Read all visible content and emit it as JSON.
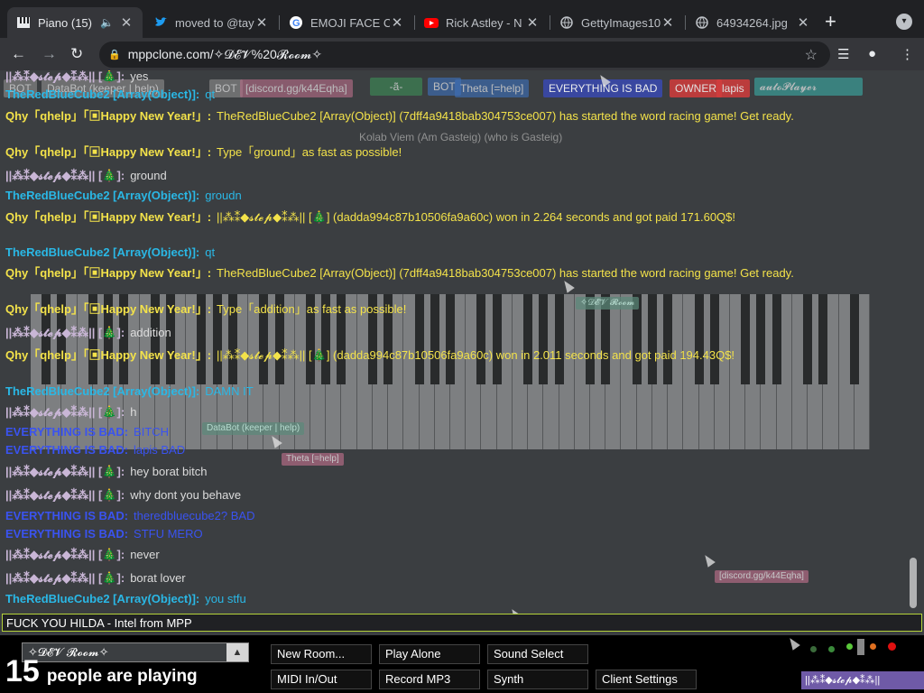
{
  "browser": {
    "tabs": [
      {
        "title": "Piano (15)",
        "icon": "piano-icon",
        "active": true
      },
      {
        "title": "moved to @tay",
        "icon": "twitter-icon"
      },
      {
        "title": "EMOJI FACE C",
        "icon": "google-icon"
      },
      {
        "title": "Rick Astley - N",
        "icon": "youtube-icon"
      },
      {
        "title": "GettyImages10",
        "icon": "globe-icon"
      },
      {
        "title": "64934264.jpg",
        "icon": "globe-icon"
      }
    ],
    "new_tab": "+",
    "address": "mppclone.com/✧𝓓𝓔𝓥%20𝓡𝓸𝓸𝓶✧"
  },
  "tags": [
    {
      "label": "BOT",
      "color": "#8a8a8a"
    },
    {
      "label": "DataBot (keeper | help)",
      "color": "#8a8a8a"
    },
    {
      "label": "BOT",
      "color": "#8a8a8a"
    },
    {
      "label": "[discord.gg/k44Eqha]",
      "color": "#b26b85"
    },
    {
      "label": "-ã-",
      "color": "#3e8a55"
    },
    {
      "label": "BOT",
      "color": "#3e6fb5"
    },
    {
      "label": "Theta [=help]",
      "color": "#3e6fb5"
    },
    {
      "label": "EVERYTHING IS BAD",
      "color": "#3949ab"
    },
    {
      "label": "OWNER",
      "color": "#d23c3c"
    },
    {
      "label": "lapis",
      "color": "#d23c3c"
    },
    {
      "label": "𝓪𝓾𝓽𝓸𝓟𝓵𝓪𝔂𝓮𝓻",
      "color": "#3aa6a0"
    },
    {
      "label": "Kolab Viem (Am Gasteig) (who is Gasteig)",
      "color": "#3b3e41"
    }
  ],
  "chat": [
    {
      "name": "||⁂⁑◆𝓼𝓽𝓮𝓹◆⁑⁂|| [🎄]:",
      "text": "yes",
      "nc": "n-pink",
      "tc": "t-light"
    },
    {
      "name": "TheRedBlueCube2 [Array(Object)]:",
      "text": "qt",
      "nc": "n-cyan",
      "tc": "t-cyan"
    },
    {
      "name": "Qhy「qhelp」「▣Happy New Year!」:",
      "text": "TheRedBlueCube2 [Array(Object)] (7dff4a9418bab304753ce007) has started the word racing game! Get ready.",
      "nc": "n-yellow",
      "tc": "t-yellow"
    },
    {
      "name": "Qhy「qhelp」「▣Happy New Year!」:",
      "text": "Type「ground」as fast as possible!",
      "nc": "n-yellow",
      "tc": "t-yellow"
    },
    {
      "name": "||⁂⁑◆𝓼𝓽𝓮𝓹◆⁑⁂|| [🎄]:",
      "text": "ground",
      "nc": "n-pink",
      "tc": "t-light"
    },
    {
      "name": "TheRedBlueCube2 [Array(Object)]:",
      "text": "groudn",
      "nc": "n-cyan",
      "tc": "t-cyan"
    },
    {
      "name": "Qhy「qhelp」「▣Happy New Year!」:",
      "text": "||⁂⁑◆𝓼𝓽𝓮𝓹◆⁑⁂|| [🎄] (dadda994c87b10506fa9a60c) won in 2.264 seconds and got paid 171.60Q$!",
      "nc": "n-yellow",
      "tc": "t-yellow"
    },
    {
      "name": "TheRedBlueCube2 [Array(Object)]:",
      "text": "qt",
      "nc": "n-cyan",
      "tc": "t-cyan"
    },
    {
      "name": "Qhy「qhelp」「▣Happy New Year!」:",
      "text": "TheRedBlueCube2 [Array(Object)] (7dff4a9418bab304753ce007) has started the word racing game! Get ready.",
      "nc": "n-yellow",
      "tc": "t-yellow"
    },
    {
      "name": "Qhy「qhelp」「▣Happy New Year!」:",
      "text": "Type「addition」as fast as possible!",
      "nc": "n-yellow",
      "tc": "t-yellow"
    },
    {
      "name": "||⁂⁑◆𝓼𝓽𝓮𝓹◆⁑⁂|| [🎄]:",
      "text": "addition",
      "nc": "n-pink",
      "tc": "t-light"
    },
    {
      "name": "Qhy「qhelp」「▣Happy New Year!」:",
      "text": "||⁂⁑◆𝓼𝓽𝓮𝓹◆⁑⁂|| [🎄] (dadda994c87b10506fa9a60c) won in 2.011 seconds and got paid 194.43Q$!",
      "nc": "n-yellow",
      "tc": "t-yellow"
    },
    {
      "name": "TheRedBlueCube2 [Array(Object)]:",
      "text": "DAMN IT",
      "nc": "n-cyan",
      "tc": "t-cyan"
    },
    {
      "name": "||⁂⁑◆𝓼𝓽𝓮𝓹◆⁑⁂|| [🎄]:",
      "text": "h",
      "nc": "n-pink",
      "tc": "t-light"
    },
    {
      "name": "EVERYTHING IS BAD:",
      "text": "BITCH",
      "nc": "n-blue",
      "tc": "t-blue"
    },
    {
      "name": "EVERYTHING IS BAD:",
      "text": "lapis BAD",
      "nc": "n-blue",
      "tc": "t-blue"
    },
    {
      "name": "||⁂⁑◆𝓼𝓽𝓮𝓹◆⁑⁂|| [🎄]:",
      "text": "hey borat bitch",
      "nc": "n-pink",
      "tc": "t-light"
    },
    {
      "name": "||⁂⁑◆𝓼𝓽𝓮𝓹◆⁑⁂|| [🎄]:",
      "text": "why dont you behave",
      "nc": "n-pink",
      "tc": "t-light"
    },
    {
      "name": "EVERYTHING IS BAD:",
      "text": "theredbluecube2? BAD",
      "nc": "n-blue",
      "tc": "t-blue"
    },
    {
      "name": "EVERYTHING IS BAD:",
      "text": "STFU MERO",
      "nc": "n-blue",
      "tc": "t-blue"
    },
    {
      "name": "||⁂⁑◆𝓼𝓽𝓮𝓹◆⁑⁂|| [🎄]:",
      "text": "never",
      "nc": "n-pink",
      "tc": "t-light"
    },
    {
      "name": "||⁂⁑◆𝓼𝓽𝓮𝓹◆⁑⁂|| [🎄]:",
      "text": "borat lover",
      "nc": "n-pink",
      "tc": "t-light"
    },
    {
      "name": "TheRedBlueCube2 [Array(Object)]:",
      "text": "you stfu",
      "nc": "n-cyan",
      "tc": "t-cyan"
    }
  ],
  "cursor_labels": [
    {
      "label": "DataBot (keeper | help)",
      "color": "#5c8a7a"
    },
    {
      "label": "Theta [=help]",
      "color": "#b26b85"
    },
    {
      "label": "[discord.gg/k44Eqha]",
      "color": "#b26b85"
    },
    {
      "label": "✧𝓓𝓔𝓥 𝓡𝓸𝓸𝓶",
      "color": "#5c8a7a"
    }
  ],
  "chat_input": {
    "value": "FUCK YOU HILDA - Intel from MPP"
  },
  "bottom": {
    "room": "✧𝓓𝓔𝓥 𝓡𝓸𝓸𝓶✧",
    "count": "15",
    "count_label": "people are playing",
    "buttons": {
      "new_room": "New Room...",
      "play_alone": "Play Alone",
      "sound_select": "Sound Select",
      "midi": "MIDI In/Out",
      "record": "Record MP3",
      "synth": "Synth",
      "client_settings": "Client Settings"
    },
    "my_name": "||⁂⁑◆𝓼𝓽𝓮𝓹◆⁑⁂||"
  }
}
